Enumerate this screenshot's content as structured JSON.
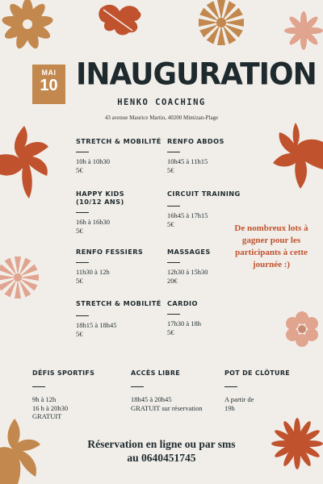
{
  "date_badge": {
    "month": "MAI",
    "day": "10"
  },
  "title": "INAUGURATION",
  "subtitle": "HENKO COACHING",
  "address": "43 avenue Maurice Martin, 40200 Mimizan-Plage",
  "activities": [
    {
      "name": "STRETCH & MOBILITÉ",
      "time": "10h à 10h30",
      "price": "5€"
    },
    {
      "name": "RENFO ABDOS",
      "time": "10h45 à 11h15",
      "price": "5€"
    },
    {
      "name": "HAPPY KIDS",
      "name2": "(10/12 ANS)",
      "time": "16h à 16h30",
      "price": "5€"
    },
    {
      "name": "CIRCUIT TRAINING",
      "time": "16h45 à 17h15",
      "price": "5€"
    },
    {
      "name": "RENFO FESSIERS",
      "time": "11h30 à 12h",
      "price": "5€"
    },
    {
      "name": "MASSAGES",
      "time": "12h30 à 15h30",
      "price": "20€"
    },
    {
      "name": "STRETCH & MOBILITÉ",
      "time": "18h15 à 18h45",
      "price": "5€"
    },
    {
      "name": "CARDIO",
      "time": "17h30 à 18h",
      "price": "5€"
    }
  ],
  "promo": "De nombreux lots à gagner pour les participants à cette journée :)",
  "bottom": [
    {
      "name": "DÉFIS SPORTIFS",
      "lines": [
        "9h à 12h",
        "16 h à 20h30",
        "GRATUIT"
      ]
    },
    {
      "name": "ACCÈS LIBRE",
      "lines": [
        "18h45 à 20h45",
        "GRATUIT sur réservation"
      ]
    },
    {
      "name": "POT DE CLÔTURE",
      "lines": [
        "A partir de",
        "19h"
      ]
    }
  ],
  "reservation": {
    "line1": "Réservation en ligne ou par sms",
    "line2": "au 0640451745"
  },
  "colors": {
    "background": "#f1eee9",
    "ochre": "#c2884e",
    "rust": "#c0522e",
    "blush": "#e0a48f",
    "ink": "#1f2a2e"
  }
}
